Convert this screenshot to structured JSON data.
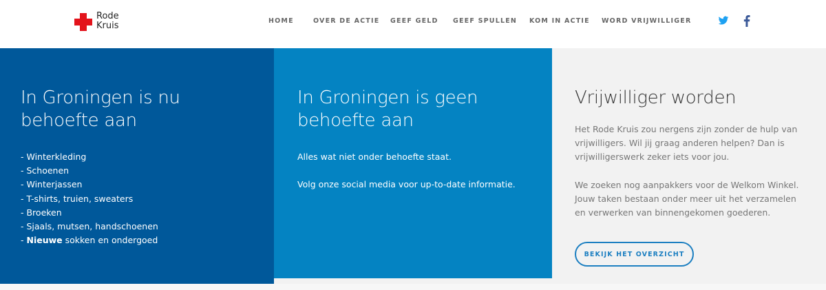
{
  "logo": {
    "line1": "Rode",
    "line2": "Kruis"
  },
  "nav": {
    "items": [
      {
        "label": "HOME"
      },
      {
        "label": "OVER DE ACTIE"
      },
      {
        "label": "GEEF GELD"
      },
      {
        "label": "GEEF SPULLEN"
      },
      {
        "label": "KOM IN ACTIE"
      },
      {
        "label": "WORD VRIJWILLIGER"
      }
    ]
  },
  "social": {
    "twitter": "twitter-icon",
    "facebook": "facebook-icon",
    "twitter_color": "#1da1f2",
    "facebook_color": "#3b5998"
  },
  "colors": {
    "dark_blue": "#00589a",
    "mid_blue": "#0483c2",
    "light_gray": "#f2f2f2",
    "red": "#e3131b",
    "button_blue": "#1c7fc1"
  },
  "need": {
    "heading_line1": "In Groningen is nu",
    "heading_line2": "behoefte aan",
    "items": [
      {
        "text": "- Winterkleding"
      },
      {
        "text": "- Schoenen"
      },
      {
        "text": "- Winterjassen"
      },
      {
        "text": "- T-shirts, truien, sweaters"
      },
      {
        "text": "- Broeken"
      },
      {
        "text": "- Sjaals, mutsen, handschoenen"
      },
      {
        "prefix": "- ",
        "bold": "Nieuwe",
        "suffix": " sokken en ondergoed"
      }
    ]
  },
  "no_need": {
    "heading_line1": "In Groningen is geen",
    "heading_line2": "behoefte aan",
    "para1": "Alles wat niet onder behoefte staat.",
    "para2": "Volg onze social media voor up-to-date informatie."
  },
  "volunteer": {
    "heading": "Vrijwilliger worden",
    "para1": "Het Rode Kruis zou nergens zijn zonder de hulp van vrijwilligers. Wil jij graag anderen helpen? Dan is vrijwilligerswerk zeker iets voor jou.",
    "para2": "We zoeken nog aanpakkers voor de Welkom Winkel. Jouw taken bestaan onder meer uit het verzamelen en verwerken van binnengekomen goederen.",
    "button": "BEKIJK HET OVERZICHT"
  }
}
